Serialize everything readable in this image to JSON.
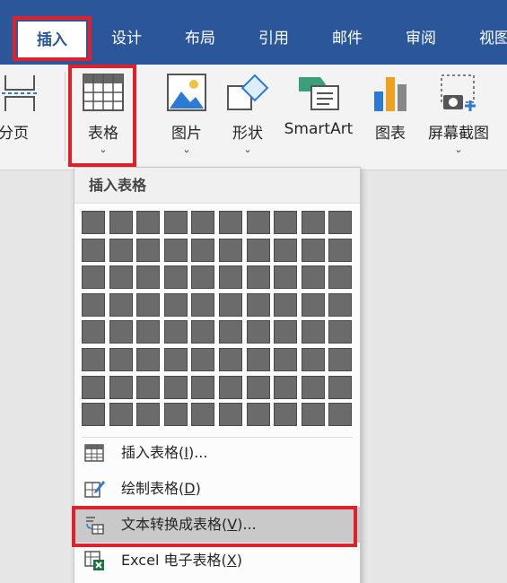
{
  "tabs": [
    {
      "label": "插入",
      "active": true
    },
    {
      "label": "设计"
    },
    {
      "label": "布局"
    },
    {
      "label": "引用"
    },
    {
      "label": "邮件"
    },
    {
      "label": "审阅"
    },
    {
      "label": "视图"
    }
  ],
  "ribbon": {
    "page_break_label": "分页",
    "table_label": "表格",
    "picture_label": "图片",
    "shapes_label": "形状",
    "smartart_label": "SmartArt",
    "chart_label": "图表",
    "screenshot_label": "屏幕截图"
  },
  "dropdown": {
    "header": "插入表格",
    "grid_cols": 10,
    "grid_rows": 8,
    "menu": [
      {
        "label": "插入表格(",
        "key": "I",
        "suffix": ")...",
        "icon": "table-grid-icon"
      },
      {
        "label": "绘制表格(",
        "key": "D",
        "suffix": ")",
        "icon": "draw-table-icon"
      },
      {
        "label": "文本转换成表格(",
        "key": "V",
        "suffix": ")...",
        "icon": "text-to-table-icon",
        "selected": true
      },
      {
        "label": "Excel 电子表格(",
        "key": "X",
        "suffix": ")",
        "icon": "excel-icon"
      }
    ]
  },
  "colors": {
    "tab_bar": "#2b579a",
    "highlight": "#e0202a",
    "grid_cell": "#6b6b6b",
    "selected_item": "#c9c9c9"
  }
}
